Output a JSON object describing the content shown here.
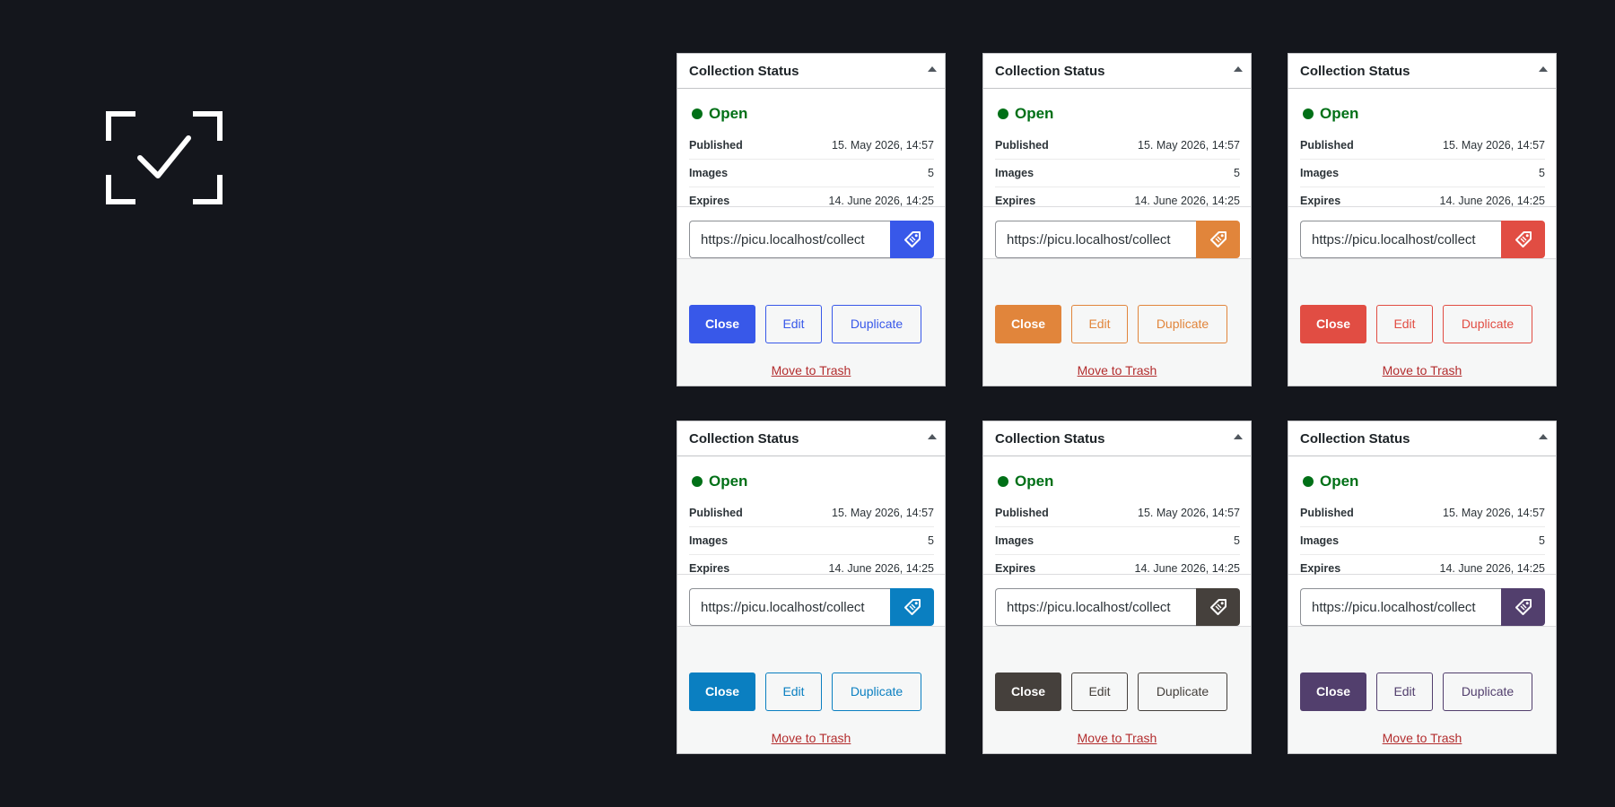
{
  "panels": [
    {
      "title": "Collection Status",
      "status": "Open",
      "published_label": "Published",
      "published_value": "15. May 2026, 14:57",
      "images_label": "Images",
      "images_value": "5",
      "expires_label": "Expires",
      "expires_value": "14. June 2026, 14:25",
      "url": "https://picu.localhost/collect",
      "close_label": "Close",
      "edit_label": "Edit",
      "duplicate_label": "Duplicate",
      "trash_label": "Move to Trash",
      "accent": "#3858e9"
    },
    {
      "title": "Collection Status",
      "status": "Open",
      "published_label": "Published",
      "published_value": "15. May 2026, 14:57",
      "images_label": "Images",
      "images_value": "5",
      "expires_label": "Expires",
      "expires_value": "14. June 2026, 14:25",
      "url": "https://picu.localhost/collect",
      "close_label": "Close",
      "edit_label": "Edit",
      "duplicate_label": "Duplicate",
      "trash_label": "Move to Trash",
      "accent": "#e1853b"
    },
    {
      "title": "Collection Status",
      "status": "Open",
      "published_label": "Published",
      "published_value": "15. May 2026, 14:57",
      "images_label": "Images",
      "images_value": "5",
      "expires_label": "Expires",
      "expires_value": "14. June 2026, 14:25",
      "url": "https://picu.localhost/collect",
      "close_label": "Close",
      "edit_label": "Edit",
      "duplicate_label": "Duplicate",
      "trash_label": "Move to Trash",
      "accent": "#e14d43"
    },
    {
      "title": "Collection Status",
      "status": "Open",
      "published_label": "Published",
      "published_value": "15. May 2026, 14:57",
      "images_label": "Images",
      "images_value": "5",
      "expires_label": "Expires",
      "expires_value": "14. June 2026, 14:25",
      "url": "https://picu.localhost/collect",
      "close_label": "Close",
      "edit_label": "Edit",
      "duplicate_label": "Duplicate",
      "trash_label": "Move to Trash",
      "accent": "#0a7fc1"
    },
    {
      "title": "Collection Status",
      "status": "Open",
      "published_label": "Published",
      "published_value": "15. May 2026, 14:57",
      "images_label": "Images",
      "images_value": "5",
      "expires_label": "Expires",
      "expires_value": "14. June 2026, 14:25",
      "url": "https://picu.localhost/collect",
      "close_label": "Close",
      "edit_label": "Edit",
      "duplicate_label": "Duplicate",
      "trash_label": "Move to Trash",
      "accent": "#45403c"
    },
    {
      "title": "Collection Status",
      "status": "Open",
      "published_label": "Published",
      "published_value": "15. May 2026, 14:57",
      "images_label": "Images",
      "images_value": "5",
      "expires_label": "Expires",
      "expires_value": "14. June 2026, 14:25",
      "url": "https://picu.localhost/collect",
      "close_label": "Close",
      "edit_label": "Edit",
      "duplicate_label": "Duplicate",
      "trash_label": "Move to Trash",
      "accent": "#523f6d"
    }
  ],
  "colors": {
    "background": "#14161c",
    "status_green": "#007017",
    "trash_red": "#b32d2e"
  },
  "icons": {
    "logo": "select-check-icon",
    "copy_link": "tag-icon",
    "collapse": "triangle-up-icon"
  }
}
